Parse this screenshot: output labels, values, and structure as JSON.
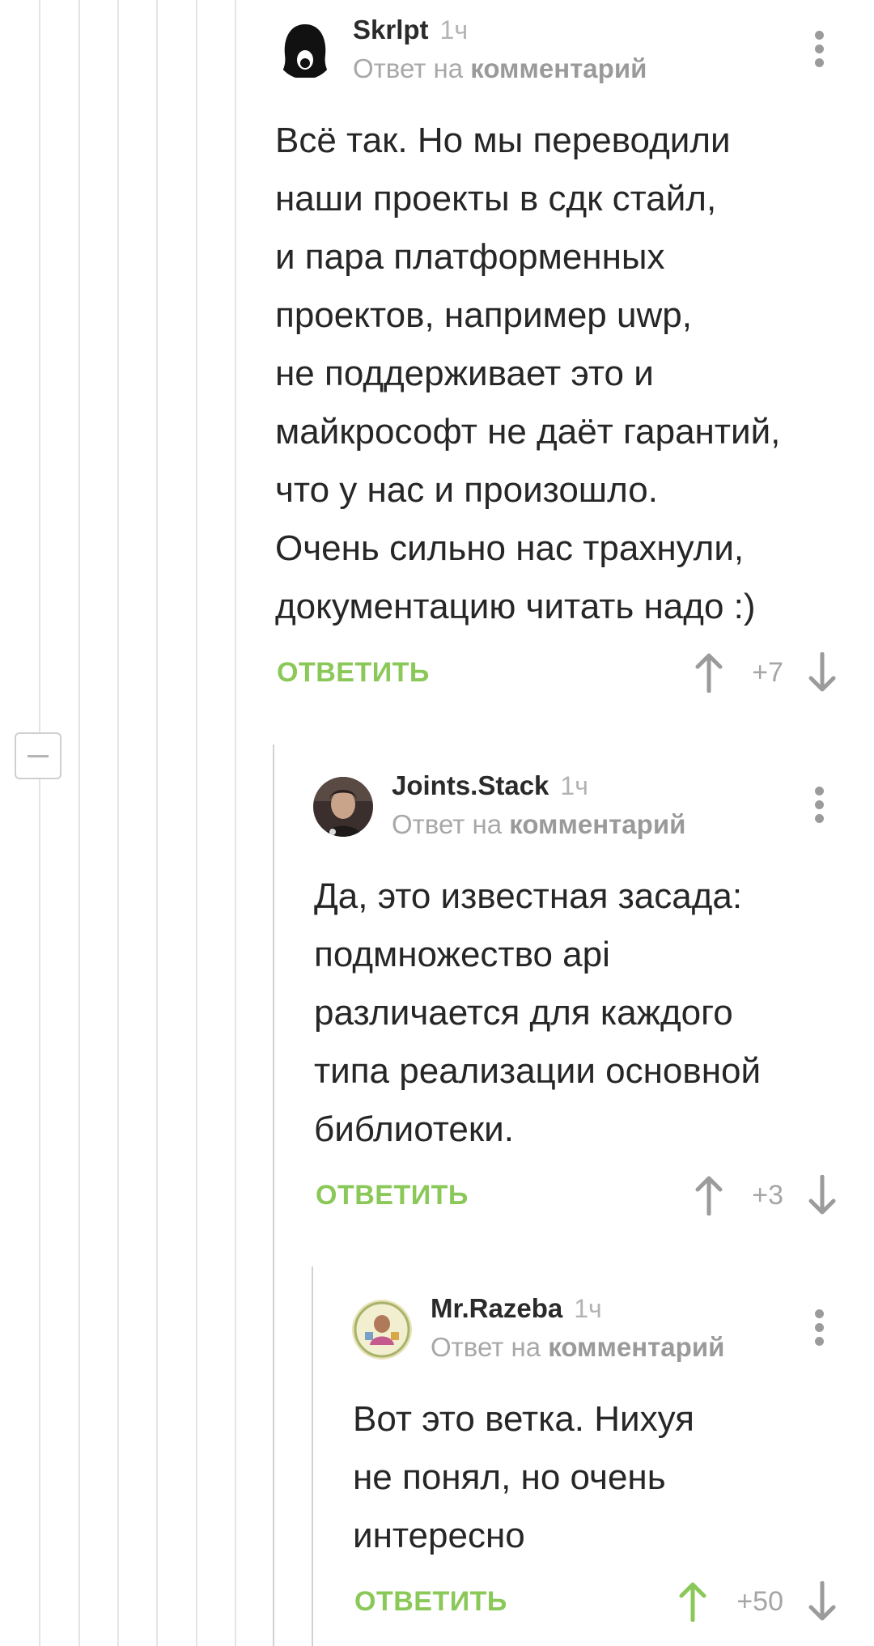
{
  "comments": [
    {
      "author": "Skrlpt",
      "time": "1ч",
      "reply_prefix": "Ответ на",
      "reply_link": "комментарий",
      "text": "Всё так. Но мы переводили\nнаши проекты в сдк стайл,\nи пара платформенных\nпроектов, например uwp,\nне поддерживает это и\nмайкрософт не даёт гарантий,\nчто у нас и произошло.\nОчень сильно нас трахнули,\nдокументацию читать надо :)",
      "reply_label": "ОТВЕТИТЬ",
      "score": "+7",
      "upvoted": false
    },
    {
      "author": "Joints.Stack",
      "time": "1ч",
      "reply_prefix": "Ответ на",
      "reply_link": "комментарий",
      "text": "Да, это известная засада:\nподмножество api\nразличается для каждого\nтипа реализации основной\nбиблиотеки.",
      "reply_label": "ОТВЕТИТЬ",
      "score": "+3",
      "upvoted": false
    },
    {
      "author": "Mr.Razeba",
      "time": "1ч",
      "reply_prefix": "Ответ на",
      "reply_link": "комментарий",
      "text": "Вот это ветка. Нихуя\nне понял, но очень\nинтересно",
      "reply_label": "ОТВЕТИТЬ",
      "score": "+50",
      "upvoted": true
    }
  ],
  "colors": {
    "accent_green": "#8ac858",
    "vote_gray": "#9b9b9b",
    "thread_line": "#e4e4e4"
  },
  "icons": [
    "avatar-skrlpt",
    "avatar-joints-stack",
    "avatar-mr-razeba",
    "more-vertical-icon",
    "arrow-up-icon",
    "arrow-down-icon",
    "collapse-minus-icon"
  ]
}
